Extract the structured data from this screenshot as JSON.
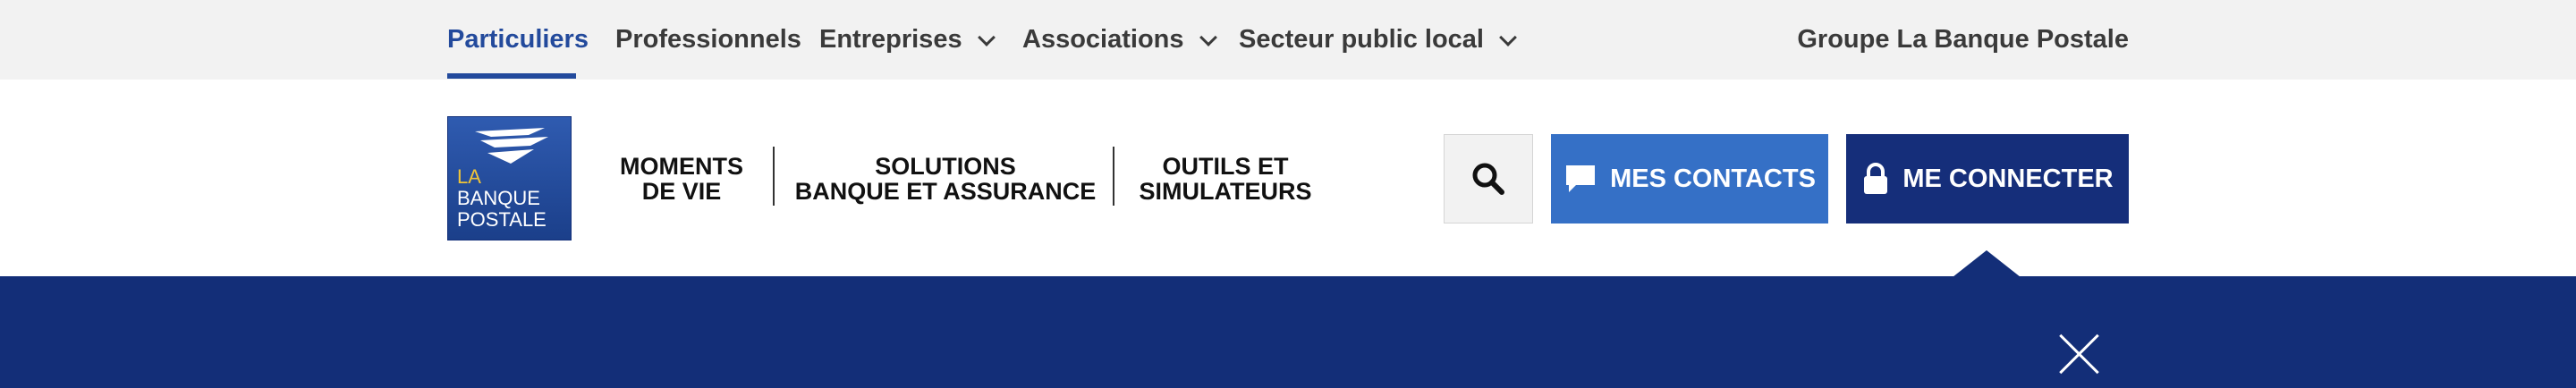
{
  "topbar": {
    "segments": [
      {
        "label": "Particuliers",
        "active": true
      },
      {
        "label": "Professionnels",
        "active": false
      },
      {
        "label": "Entreprises",
        "has_dropdown": true
      },
      {
        "label": "Associations",
        "has_dropdown": true
      },
      {
        "label": "Secteur public local",
        "has_dropdown": true
      }
    ],
    "group_link": "Groupe La Banque Postale"
  },
  "logo": {
    "line1": "LA",
    "line2": "BANQUE",
    "line3": "POSTALE"
  },
  "nav": [
    {
      "line1": "MOMENTS",
      "line2": "DE VIE"
    },
    {
      "line1": "SOLUTIONS",
      "line2": "BANQUE ET ASSURANCE"
    },
    {
      "line1": "OUTILS ET",
      "line2": "SIMULATEURS"
    }
  ],
  "actions": {
    "search_icon": "search-icon",
    "contacts_label": "MES CONTACTS",
    "contacts_icon": "chat-bubble-icon",
    "connect_label": "ME CONNECTER",
    "connect_icon": "lock-icon"
  },
  "colors": {
    "primary_blue": "#234a9c",
    "contacts_blue": "#3570c6",
    "dark_navy": "#152e7a",
    "panel_navy": "#132e78",
    "logo_yellow": "#f0c437"
  },
  "panel": {
    "close_icon": "close-icon"
  }
}
